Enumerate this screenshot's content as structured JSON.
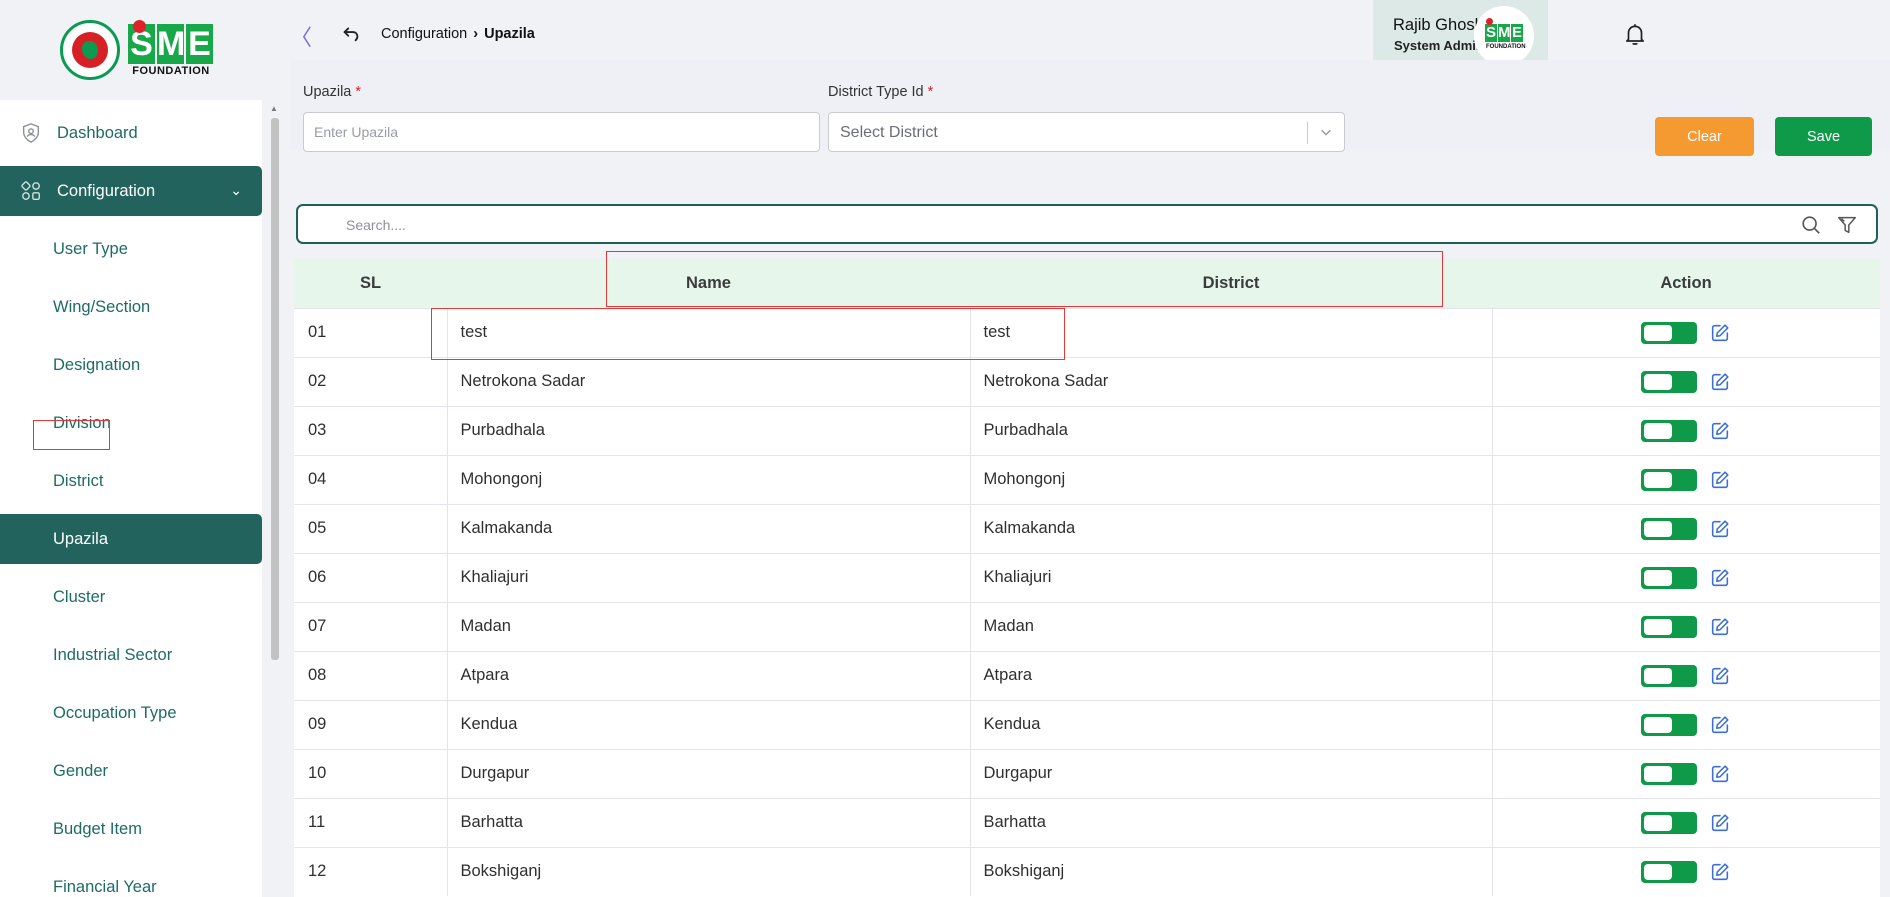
{
  "sidebar": {
    "brand": {
      "logo_letters": [
        "S",
        "M",
        "E"
      ],
      "logo_subtitle": "FOUNDATION"
    },
    "items": [
      {
        "label": "Dashboard",
        "icon": "shield-icon",
        "active": false
      },
      {
        "label": "Configuration",
        "icon": "modules-icon",
        "active": true,
        "expanded": true
      },
      {
        "label": "User Type"
      },
      {
        "label": "Wing/Section"
      },
      {
        "label": "Designation"
      },
      {
        "label": "Division"
      },
      {
        "label": "District"
      },
      {
        "label": "Upazila",
        "active": true
      },
      {
        "label": "Cluster"
      },
      {
        "label": "Industrial Sector"
      },
      {
        "label": "Occupation Type"
      },
      {
        "label": "Gender"
      },
      {
        "label": "Budget Item"
      },
      {
        "label": "Financial Year"
      }
    ]
  },
  "header": {
    "breadcrumb": {
      "parent": "Configuration",
      "current": "Upazila"
    },
    "user": {
      "name": "Rajib Ghosh",
      "role": "System Admin"
    }
  },
  "form": {
    "upazila": {
      "label": "Upazila",
      "required_mark": "*",
      "placeholder": "Enter Upazila",
      "value": ""
    },
    "district": {
      "label": "District Type Id",
      "required_mark": "*",
      "placeholder": "Select District"
    },
    "clear_label": "Clear",
    "save_label": "Save"
  },
  "search": {
    "placeholder": "Search...."
  },
  "table": {
    "columns": [
      "SL",
      "Name",
      "District",
      "Action"
    ],
    "rows": [
      {
        "sl": "01",
        "name": "test",
        "district": "test",
        "active": true
      },
      {
        "sl": "02",
        "name": "Netrokona Sadar",
        "district": "Netrokona Sadar",
        "active": true
      },
      {
        "sl": "03",
        "name": "Purbadhala",
        "district": "Purbadhala",
        "active": true
      },
      {
        "sl": "04",
        "name": "Mohongonj",
        "district": "Mohongonj",
        "active": true
      },
      {
        "sl": "05",
        "name": "Kalmakanda",
        "district": "Kalmakanda",
        "active": true
      },
      {
        "sl": "06",
        "name": "Khaliajuri",
        "district": "Khaliajuri",
        "active": true
      },
      {
        "sl": "07",
        "name": "Madan",
        "district": "Madan",
        "active": true
      },
      {
        "sl": "08",
        "name": "Atpara",
        "district": "Atpara",
        "active": true
      },
      {
        "sl": "09",
        "name": "Kendua",
        "district": "Kendua",
        "active": true
      },
      {
        "sl": "10",
        "name": "Durgapur",
        "district": "Durgapur",
        "active": true
      },
      {
        "sl": "11",
        "name": "Barhatta",
        "district": "Barhatta",
        "active": true
      },
      {
        "sl": "12",
        "name": "Bokshiganj",
        "district": "Bokshiganj",
        "active": true
      }
    ]
  },
  "colors": {
    "primary": "#22635e",
    "save": "#0f9a49",
    "clear": "#f49a30",
    "table_header_bg": "#e6f6ea",
    "annotation": "#e23a3a"
  }
}
